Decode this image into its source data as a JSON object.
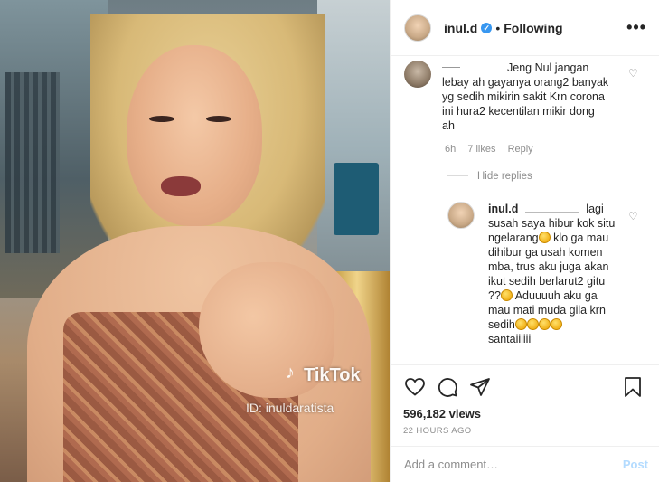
{
  "media": {
    "watermark_brand": "TikTok",
    "watermark_id": "ID: inuldaratista"
  },
  "header": {
    "username": "inul.d",
    "separator": "•",
    "follow_status": "Following",
    "more_icon": "more-horizontal-icon"
  },
  "comments": [
    {
      "text_lines": [
        "Jeng Nul jangan",
        "lebay ah gayanya orang2 banyak",
        "yg sedih mikirin sakit Krn corona",
        "ini hura2 kecentilan mikir dong",
        "ah"
      ],
      "time": "6h",
      "likes": "7 likes",
      "reply": "Reply"
    }
  ],
  "hide_replies": "Hide replies",
  "reply": {
    "username": "inul.d",
    "lines": [
      "lagi",
      "susah saya hibur kok situ",
      "ngelarang",
      "klo ga mau",
      "dihibur ga usah komen",
      "mba, trus aku juga akan",
      "ikut sedih berlarut2 gitu",
      "??",
      "Aduuuuh aku ga",
      "mau mati muda gila krn",
      "sedih",
      "santaiiiiii"
    ]
  },
  "actions": {
    "icons": [
      "heart-icon",
      "comment-icon",
      "share-icon",
      "bookmark-icon"
    ],
    "views": "596,182 views",
    "timestamp": "22 HOURS AGO"
  },
  "add_comment": {
    "placeholder": "Add a comment…",
    "post_label": "Post"
  },
  "colors": {
    "verified": "#3897f0",
    "post_disabled": "#b3dbff",
    "secondary_text": "#8e8e8e"
  }
}
